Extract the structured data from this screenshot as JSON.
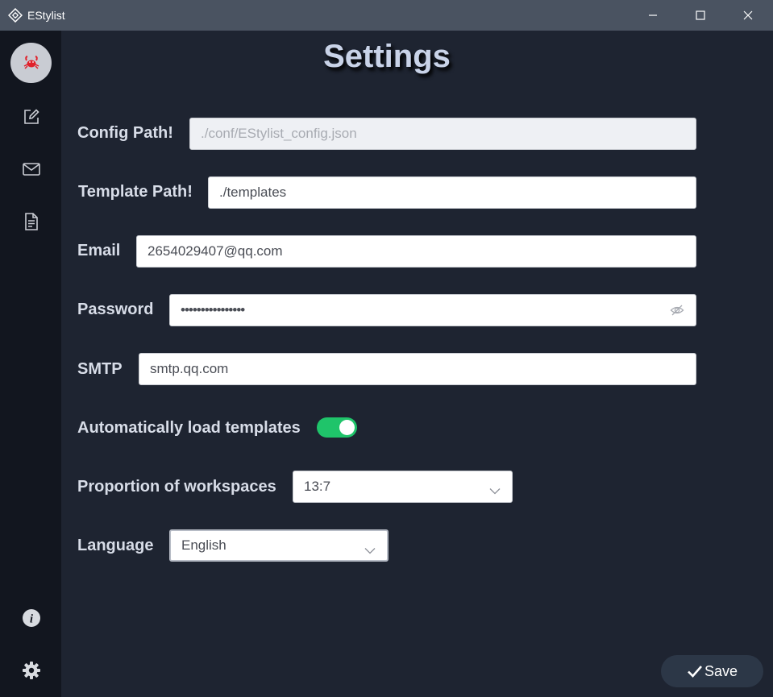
{
  "window": {
    "title": "EStylist",
    "icon": "estylist-logo-icon",
    "controls": [
      "minimize-icon",
      "maximize-icon",
      "close-icon"
    ]
  },
  "sidebar": {
    "items": [
      {
        "name": "crab-logo-icon",
        "active": true
      },
      {
        "name": "edit-icon"
      },
      {
        "name": "mail-icon"
      },
      {
        "name": "document-icon"
      }
    ],
    "bottom_items": [
      {
        "name": "info-icon"
      },
      {
        "name": "settings-gear-icon"
      }
    ]
  },
  "page": {
    "title": "Settings"
  },
  "settings": {
    "config_path": {
      "label": "Config Path!",
      "value": "./conf/EStylist_config.json",
      "disabled": true
    },
    "template_path": {
      "label": "Template Path!",
      "value": "./templates"
    },
    "email": {
      "label": "Email",
      "value": "2654029407@qq.com"
    },
    "password": {
      "label": "Password",
      "value": "••••••••••••••••",
      "icon": "eye-off-icon"
    },
    "smtp": {
      "label": "SMTP",
      "value": "smtp.qq.com"
    },
    "auto_load": {
      "label": "Automatically load templates",
      "enabled": true
    },
    "proportion": {
      "label": "Proportion of workspaces",
      "value": "13:7"
    },
    "language": {
      "label": "Language",
      "value": "English"
    }
  },
  "actions": {
    "save_label": "Save",
    "save_icon": "check-icon"
  },
  "colors": {
    "toggle_on": "#1fc46a",
    "background": "#1e2431",
    "sidebar": "#12161f",
    "accent_icon": "#e0202a"
  }
}
